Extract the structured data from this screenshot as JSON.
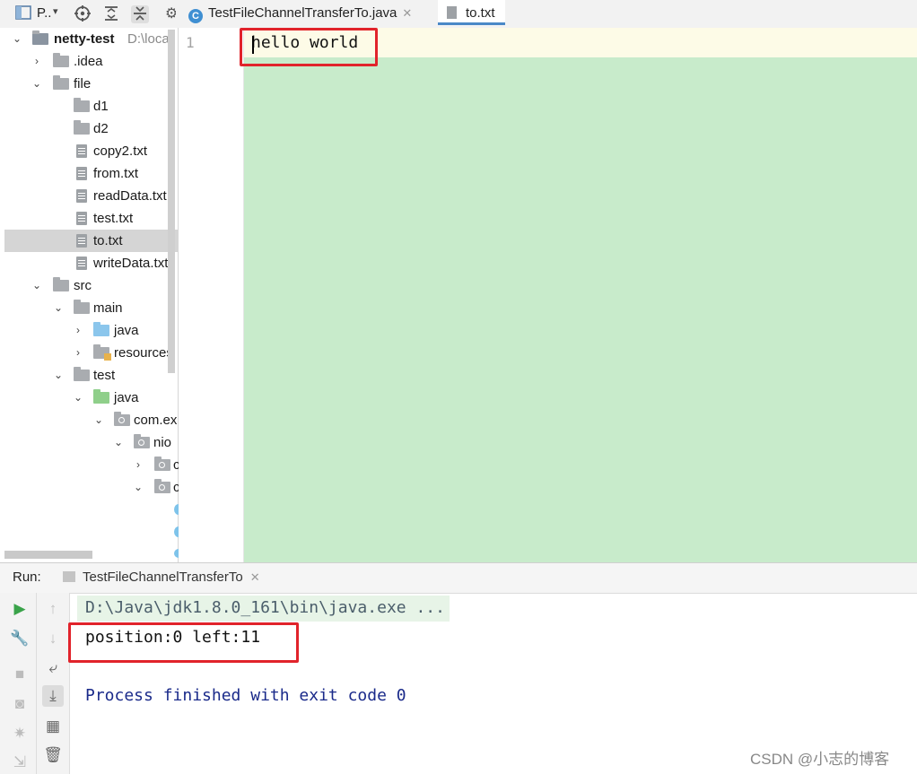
{
  "toolbar": {
    "project_label": "P..",
    "icons": [
      "project-view-icon",
      "locate-icon",
      "expand-all-icon",
      "collapse-all-icon",
      "gear-icon"
    ]
  },
  "tabs": [
    {
      "label": "TestFileChannelTransferTo.java",
      "icon": "java-class-icon",
      "active": false
    },
    {
      "label": "to.txt",
      "icon": "text-file-icon",
      "active": true
    }
  ],
  "project_tree": {
    "root": {
      "label": "netty-test",
      "path": "D:\\local"
    },
    "items": [
      {
        "label": ".idea"
      },
      {
        "label": "file"
      },
      {
        "label": "d1"
      },
      {
        "label": "d2"
      },
      {
        "label": "copy2.txt"
      },
      {
        "label": "from.txt"
      },
      {
        "label": "readData.txt"
      },
      {
        "label": "test.txt"
      },
      {
        "label": "to.txt",
        "selected": true
      },
      {
        "label": "writeData.txt"
      },
      {
        "label": "src"
      },
      {
        "label": "main"
      },
      {
        "label": "java"
      },
      {
        "label": "resources"
      },
      {
        "label": "test"
      },
      {
        "label": "java"
      },
      {
        "label": "com.ex"
      },
      {
        "label": "nio"
      },
      {
        "label": "c"
      },
      {
        "label": "c"
      }
    ]
  },
  "editor": {
    "line_number": "1",
    "content": "hello world"
  },
  "run_panel": {
    "label": "Run:",
    "tab_label": "TestFileChannelTransferTo",
    "output": {
      "command": "D:\\Java\\jdk1.8.0_161\\bin\\java.exe ...",
      "line1": "position:0 left:11",
      "line2": "Process finished with exit code 0"
    }
  },
  "watermark": "CSDN @小志的博客",
  "colors": {
    "highlight_box": "#e1232b",
    "editor_bg": "#c8ebcb",
    "current_line": "#fdfbe7",
    "exit_text": "#1a2a8a"
  }
}
